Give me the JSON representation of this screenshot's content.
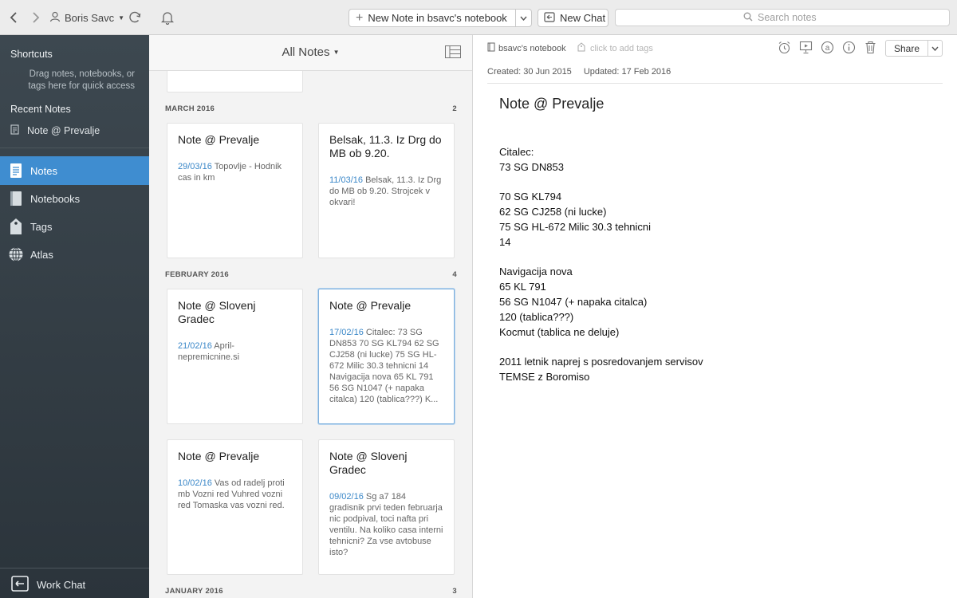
{
  "toolbar": {
    "user_name": "Boris Savc",
    "new_note_label": "New Note in bsavc's notebook",
    "new_chat_label": "New Chat",
    "search_placeholder": "Search notes"
  },
  "sidebar": {
    "shortcuts_label": "Shortcuts",
    "shortcuts_hint": "Drag notes, notebooks, or tags here for quick access",
    "recent_label": "Recent Notes",
    "recent_items": [
      "Note @ Prevalje"
    ],
    "nav": [
      {
        "label": "Notes",
        "icon": "notes-icon",
        "active": true
      },
      {
        "label": "Notebooks",
        "icon": "notebook-icon",
        "active": false
      },
      {
        "label": "Tags",
        "icon": "tag-icon",
        "active": false
      },
      {
        "label": "Atlas",
        "icon": "globe-icon",
        "active": false
      }
    ],
    "work_chat_label": "Work Chat"
  },
  "notelist": {
    "title": "All Notes",
    "sections": [
      {
        "label": "MARCH 2016",
        "count": "2",
        "notes": [
          {
            "title": "Note @ Prevalje",
            "date": "29/03/16",
            "snippet": "Topovlje - Hodnik cas in km"
          },
          {
            "title": "Belsak, 11.3. Iz Drg do MB ob 9.20.",
            "date": "11/03/16",
            "snippet": "Belsak, 11.3. Iz Drg do MB ob 9.20. Strojcek v okvari!"
          }
        ]
      },
      {
        "label": "FEBRUARY 2016",
        "count": "4",
        "notes": [
          {
            "title": "Note @ Slovenj Gradec",
            "date": "21/02/16",
            "snippet": "April-nepremicnine.si"
          },
          {
            "title": "Note @ Prevalje",
            "date": "17/02/16",
            "snippet": "Citalec: 73 SG DN853 70 SG KL794 62 SG CJ258 (ni lucke) 75 SG HL-672 Milic 30.3 tehnicni 14 Navigacija nova 65 KL 791 56 SG N1047 (+ napaka citalca) 120 (tablica???) K..."
          },
          {
            "title": "Note @ Prevalje",
            "date": "10/02/16",
            "snippet": "Vas od radelj proti mb Vozni red Vuhred vozni red Tomaska vas vozni red."
          },
          {
            "title": "Note @ Slovenj Gradec",
            "date": "09/02/16",
            "snippet": "Sg a7 184 gradisnik prvi teden februarja nic podpival, toci nafta pri ventilu. Na koliko casa interni tehnicni? Za vse avtobuse isto?"
          }
        ]
      },
      {
        "label": "JANUARY 2016",
        "count": "3",
        "notes": []
      }
    ]
  },
  "editor": {
    "notebook": "bsavc's notebook",
    "tags_placeholder": "click to add tags",
    "share_label": "Share",
    "created": "Created: 30 Jun 2015",
    "updated": "Updated: 17 Feb 2016",
    "title": "Note @ Prevalje",
    "body_lines": [
      "Citalec:",
      "73 SG DN853",
      "",
      "70 SG KL794",
      "62 SG CJ258 (ni lucke)",
      "75 SG HL-672 Milic 30.3 tehnicni",
      "14",
      "",
      "Navigacija nova",
      "65 KL 791",
      "56 SG N1047 (+ napaka citalca)",
      "120 (tablica???)",
      "Kocmut (tablica ne deluje)",
      "",
      "2011 letnik naprej s posredovanjem servisov",
      "TEMSE z Boromiso"
    ]
  },
  "colors": {
    "accent": "#3f8dd0",
    "date_link": "#3a87c8",
    "sidebar_bg": "#2f383f"
  }
}
